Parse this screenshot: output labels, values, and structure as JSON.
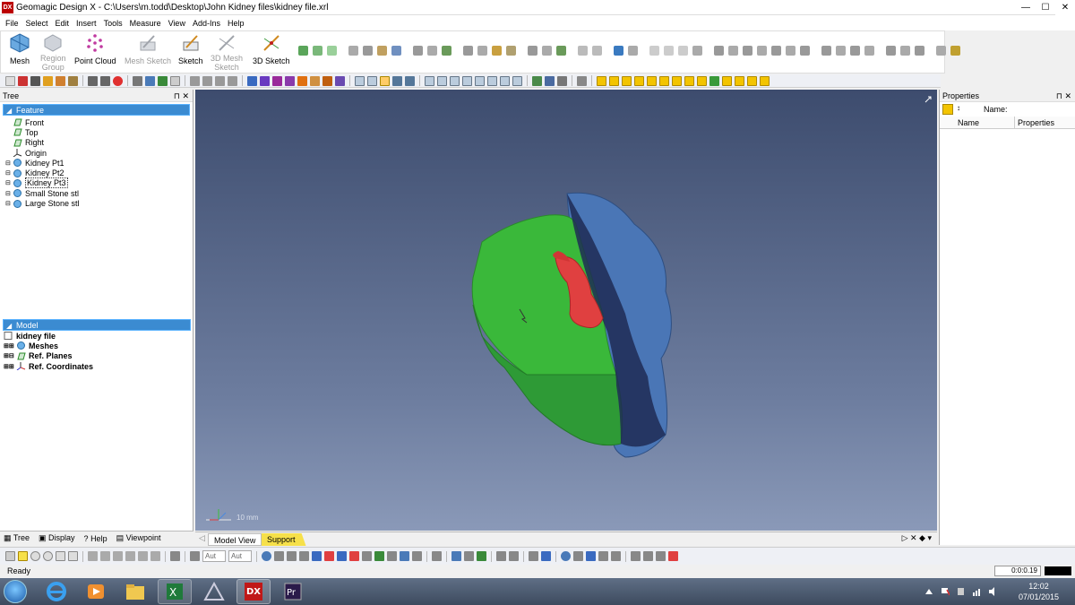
{
  "window": {
    "logo": "DX",
    "title": "Geomagic Design X - C:\\Users\\m.todd\\Desktop\\John Kidney files\\kidney file.xrl",
    "controls": {
      "minimize": "—",
      "maximize": "☐",
      "close": "✕"
    }
  },
  "menu": [
    "File",
    "Select",
    "Edit",
    "Insert",
    "Tools",
    "Measure",
    "View",
    "Add-Ins",
    "Help"
  ],
  "ribbon": {
    "mesh": "Mesh",
    "region_group_1": "Region",
    "region_group_2": "Group",
    "point_cloud": "Point Cloud",
    "mesh_sketch": "Mesh Sketch",
    "sketch": "Sketch",
    "mesh_3d_sketch_1": "3D Mesh",
    "mesh_3d_sketch_2": "Sketch",
    "sketch_3d": "3D Sketch"
  },
  "tree_panel": {
    "title": "Tree",
    "pins": "⊓ ✕",
    "feature_header": "Feature",
    "features": [
      "Front",
      "Top",
      "Right",
      "Origin",
      "Kidney Pt1",
      "Kidney Pt2",
      "Kidney Pt3",
      "Small Stone stl",
      "Large Stone stl"
    ],
    "model_header": "Model",
    "model_root": "kidney file",
    "model_items": [
      "Meshes",
      "Ref. Planes",
      "Ref. Coordinates"
    ]
  },
  "left_tabs": [
    "Tree",
    "Display",
    "Help",
    "Viewpoint"
  ],
  "viewport": {
    "scale": "10 mm",
    "tabs": [
      "Model View",
      "Support"
    ],
    "nav": "▷ ✕ ◆ ▾"
  },
  "properties_panel": {
    "title": "Properties",
    "pins": "⊓ ✕",
    "name_label": "Name:",
    "columns": [
      "Name",
      "Properties"
    ]
  },
  "bottom_toolbar": {
    "aut1": "Aut",
    "aut2": "Aut"
  },
  "status": {
    "text": "Ready",
    "timer": "0:0:0.19"
  },
  "taskbar": {
    "time": "12:02",
    "date": "07/01/2015"
  },
  "colors": {
    "kidney_blue": "#4a76b6",
    "kidney_green": "#3ab83a",
    "stone_red": "#e04040",
    "selection_blue": "#3b8bd1",
    "support_tab": "#f6e04a"
  }
}
